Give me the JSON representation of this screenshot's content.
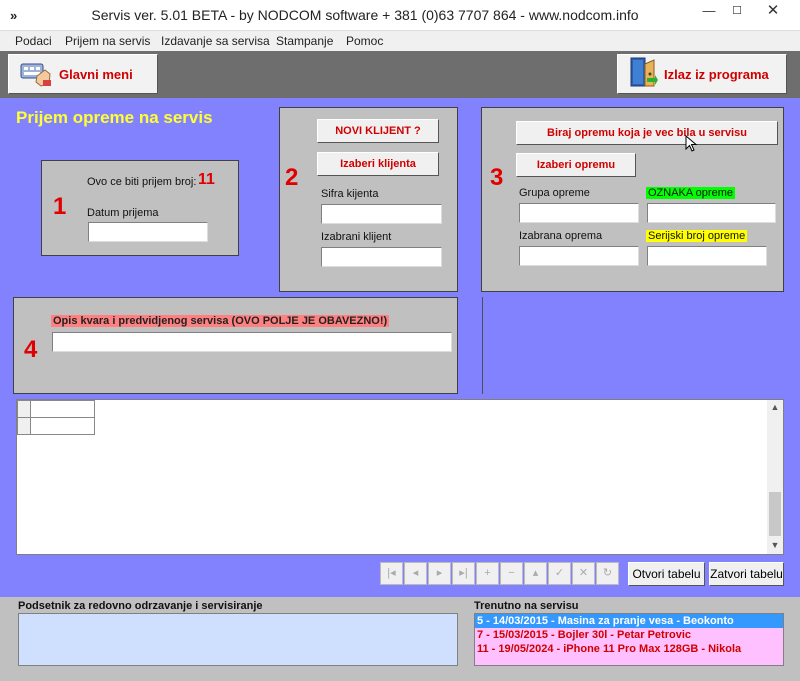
{
  "window": {
    "app_icon": "»",
    "title": "Servis ver. 5.01 BETA - by NODCOM software  + 381 (0)63 7707 864 - www.nodcom.info",
    "min": "—",
    "max": "☐",
    "close": "✕"
  },
  "menu": {
    "items": [
      "Podaci",
      "Prijem na servis",
      "Izdavanje sa servisa",
      "Stampanje",
      "Pomoc"
    ]
  },
  "toolbar": {
    "main_menu_label": "Glavni meni",
    "main_menu_icon": "keyboard-hand-icon",
    "exit_label": "Izlaz iz programa",
    "exit_icon": "door-exit-icon"
  },
  "heading": "Prijem opreme na servis",
  "panel1": {
    "step": "1",
    "intake_label": "Ovo ce biti prijem broj:",
    "intake_number": "11",
    "date_label": "Datum prijema",
    "date_value": ""
  },
  "panel2": {
    "step": "2",
    "new_client_button": "NOVI KLIJENT ?",
    "choose_client_button": "Izaberi klijenta",
    "client_code_label": "Sifra kijenta",
    "client_code_value": "",
    "selected_client_label": "Izabrani klijent",
    "selected_client_value": ""
  },
  "panel3": {
    "step": "3",
    "previous_equipment_button": "Biraj opremu koja je vec bila u servisu",
    "choose_equipment_button": "Izaberi opremu",
    "group_label": "Grupa opreme",
    "group_value": "",
    "tag_label": "OZNAKA opreme",
    "tag_value": "",
    "selected_equipment_label": "Izabrana oprema",
    "selected_equipment_value": "",
    "serial_label": "Serijski broj opreme",
    "serial_value": ""
  },
  "panel4": {
    "step": "4",
    "fault_label": "Opis kvara i predvidjenog servisa (OVO POLJE JE OBAVEZNO!)",
    "fault_value": ""
  },
  "table_buttons": {
    "open": "Otvori tabelu",
    "close": "Zatvori tabelu",
    "nav": [
      "first-record-icon",
      "prev-record-icon",
      "next-record-icon",
      "last-record-icon",
      "new-record-icon",
      "delete-record-icon",
      "edit-record-icon",
      "post-record-icon",
      "cancel-record-icon",
      "refresh-record-icon"
    ]
  },
  "reminder": {
    "title": "Podsetnik za redovno odrzavanje i servisiranje"
  },
  "current_service": {
    "title": "Trenutno na servisu",
    "rows": [
      "5 - 14/03/2015 - Masina za pranje vesa - Beokonto",
      "7 - 15/03/2015 - Bojler 30l - Petar Petrovic",
      "11 - 19/05/2024 - iPhone 11 Pro Max 128GB - Nikola"
    ]
  },
  "colors": {
    "main_bg": "#8282ff",
    "accent_red": "#d00000",
    "heading_yellow": "#ffff33",
    "list_pink": "#ffc0ff",
    "selected_blue": "#3399ff"
  }
}
